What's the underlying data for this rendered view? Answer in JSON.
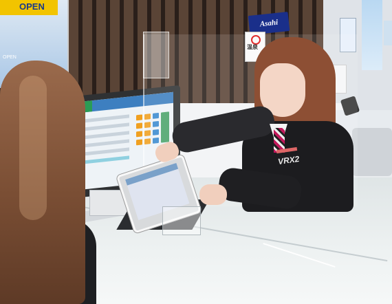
{
  "signs": {
    "open_poster": "OPEN",
    "poster_small": "OPEN",
    "asahi_sign": "Asahi",
    "small_sign": "温泉"
  },
  "uniform": {
    "chest_logo": "VRX2"
  },
  "colors": {
    "wood_slat": "#5a4436",
    "desk": "#eef2f2",
    "staff_jacket": "#1c1c1f",
    "hair_staff": "#8d4f34",
    "hair_customer": "#7a4e34",
    "asahi_blue": "#1a2f8a",
    "poster_yellow": "#f2c400"
  }
}
